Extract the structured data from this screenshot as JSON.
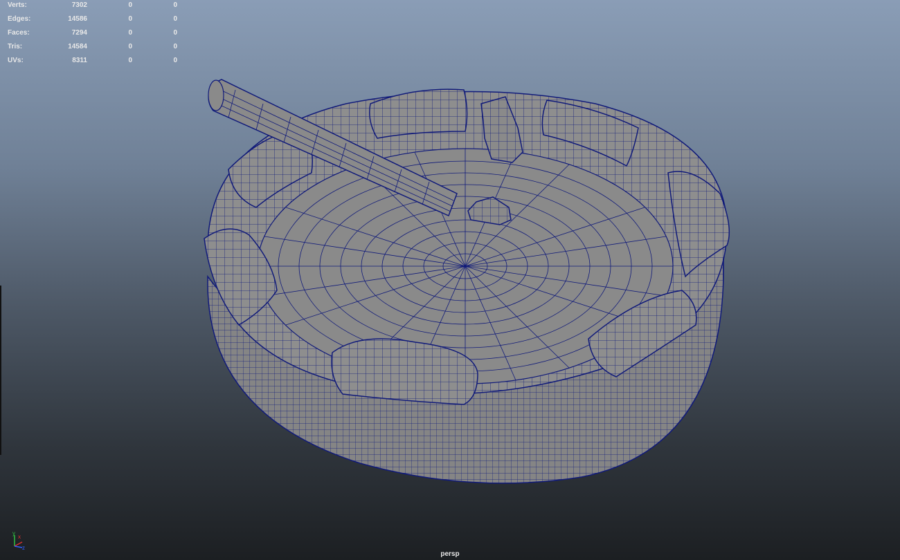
{
  "hud": {
    "rows": [
      {
        "label": "Verts:",
        "v1": "7302",
        "v2": "0",
        "v3": "0"
      },
      {
        "label": "Edges:",
        "v1": "14586",
        "v2": "0",
        "v3": "0"
      },
      {
        "label": "Faces:",
        "v1": "7294",
        "v2": "0",
        "v3": "0"
      },
      {
        "label": "Tris:",
        "v1": "14584",
        "v2": "0",
        "v3": "0"
      },
      {
        "label": "UVs:",
        "v1": "8311",
        "v2": "0",
        "v3": "0"
      }
    ]
  },
  "camera": {
    "name": "persp"
  },
  "axis_gizmo": {
    "y": "y",
    "x": "x",
    "z": "z"
  },
  "colors": {
    "wire": "#101a7a",
    "surface": "#8c8c8c",
    "axis_x": "#e03030",
    "axis_y": "#30c040",
    "axis_z": "#3060ff"
  }
}
